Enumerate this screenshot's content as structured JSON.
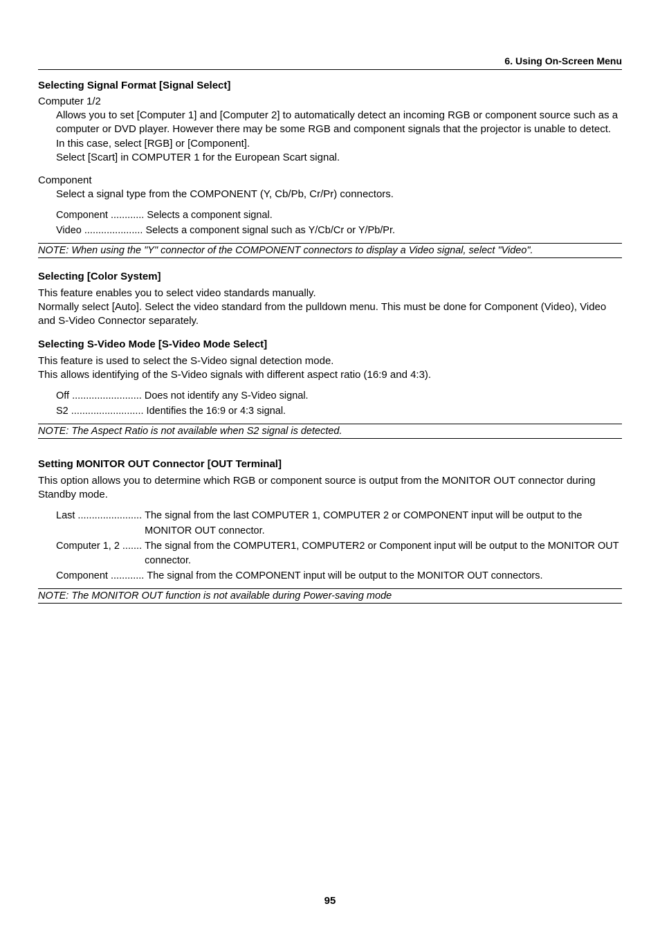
{
  "header": "6. Using On-Screen Menu",
  "s1": {
    "title": "Selecting Signal Format [Signal Select]",
    "label1": "Computer 1/2",
    "para1": "Allows you to set [Computer 1] and [Computer 2] to automatically detect an incoming RGB or component source such as a computer or DVD player. However there may be some RGB and component signals that the projector is unable to detect. In this case, select [RGB] or [Component].",
    "para1b": "Select [Scart] in COMPUTER 1 for the European Scart signal.",
    "label2": "Component",
    "para2": "Select a signal type from the COMPONENT (Y, Cb/Pb, Cr/Pr) connectors.",
    "d1t": "Component ............ ",
    "d1d": "Selects a component signal.",
    "d2t": "Video ..................... ",
    "d2d": "Selects a component signal such as Y/Cb/Cr or Y/Pb/Pr.",
    "note": "NOTE: When using the \"Y\" connector of the COMPONENT connectors to display a Video signal, select \"Video\"."
  },
  "s2": {
    "title": "Selecting [Color System]",
    "p1": "This feature enables you to select video standards manually.",
    "p2": "Normally select [Auto]. Select the video standard from the pulldown menu. This must be done for Component (Video), Video and S-Video Connector separately."
  },
  "s3": {
    "title": "Selecting S-Video Mode [S-Video Mode Select]",
    "p1": "This feature is used to select the S-Video signal detection mode.",
    "p2": "This allows identifying of the S-Video signals with different aspect ratio (16:9 and 4:3).",
    "d1t": "Off ......................... ",
    "d1d": "Does not identify any S-Video signal.",
    "d2t": "S2 .......................... ",
    "d2d": "Identifies the 16:9 or 4:3 signal.",
    "note": "NOTE: The Aspect Ratio is not available when S2 signal is detected."
  },
  "s4": {
    "title": "Setting MONITOR OUT Connector [OUT Terminal]",
    "p1": "This option allows you to determine which RGB or component source is output from the MONITOR OUT connector during Standby mode.",
    "d1t": "Last ....................... ",
    "d1d": "The signal from the last COMPUTER 1, COMPUTER 2 or COMPONENT input will be output to the MONITOR OUT connector.",
    "d2t": "Computer 1, 2 ....... ",
    "d2d": "The signal from the COMPUTER1, COMPUTER2 or Component input will be output to the MONITOR OUT connector.",
    "d3t": "Component ............ ",
    "d3d": "The signal from the COMPONENT input will be output to the MONITOR OUT connectors.",
    "note": "NOTE: The MONITOR OUT function is not available during Power-saving mode"
  },
  "page": "95"
}
